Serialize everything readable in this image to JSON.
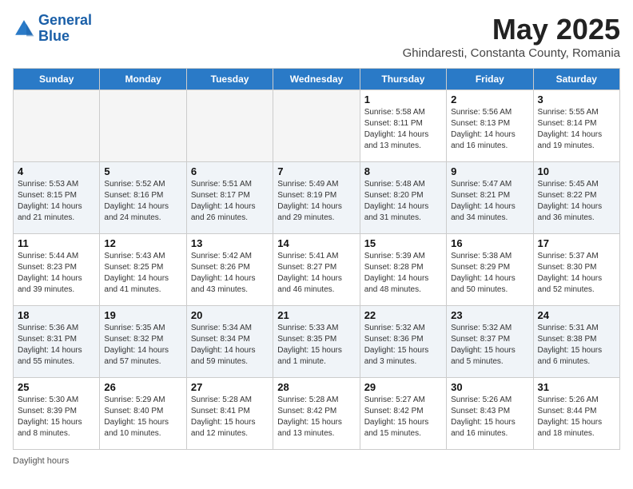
{
  "header": {
    "logo_line1": "General",
    "logo_line2": "Blue",
    "month": "May 2025",
    "location": "Ghindaresti, Constanta County, Romania"
  },
  "days_of_week": [
    "Sunday",
    "Monday",
    "Tuesday",
    "Wednesday",
    "Thursday",
    "Friday",
    "Saturday"
  ],
  "weeks": [
    [
      {
        "day": "",
        "info": ""
      },
      {
        "day": "",
        "info": ""
      },
      {
        "day": "",
        "info": ""
      },
      {
        "day": "",
        "info": ""
      },
      {
        "day": "1",
        "info": "Sunrise: 5:58 AM\nSunset: 8:11 PM\nDaylight: 14 hours\nand 13 minutes."
      },
      {
        "day": "2",
        "info": "Sunrise: 5:56 AM\nSunset: 8:13 PM\nDaylight: 14 hours\nand 16 minutes."
      },
      {
        "day": "3",
        "info": "Sunrise: 5:55 AM\nSunset: 8:14 PM\nDaylight: 14 hours\nand 19 minutes."
      }
    ],
    [
      {
        "day": "4",
        "info": "Sunrise: 5:53 AM\nSunset: 8:15 PM\nDaylight: 14 hours\nand 21 minutes."
      },
      {
        "day": "5",
        "info": "Sunrise: 5:52 AM\nSunset: 8:16 PM\nDaylight: 14 hours\nand 24 minutes."
      },
      {
        "day": "6",
        "info": "Sunrise: 5:51 AM\nSunset: 8:17 PM\nDaylight: 14 hours\nand 26 minutes."
      },
      {
        "day": "7",
        "info": "Sunrise: 5:49 AM\nSunset: 8:19 PM\nDaylight: 14 hours\nand 29 minutes."
      },
      {
        "day": "8",
        "info": "Sunrise: 5:48 AM\nSunset: 8:20 PM\nDaylight: 14 hours\nand 31 minutes."
      },
      {
        "day": "9",
        "info": "Sunrise: 5:47 AM\nSunset: 8:21 PM\nDaylight: 14 hours\nand 34 minutes."
      },
      {
        "day": "10",
        "info": "Sunrise: 5:45 AM\nSunset: 8:22 PM\nDaylight: 14 hours\nand 36 minutes."
      }
    ],
    [
      {
        "day": "11",
        "info": "Sunrise: 5:44 AM\nSunset: 8:23 PM\nDaylight: 14 hours\nand 39 minutes."
      },
      {
        "day": "12",
        "info": "Sunrise: 5:43 AM\nSunset: 8:25 PM\nDaylight: 14 hours\nand 41 minutes."
      },
      {
        "day": "13",
        "info": "Sunrise: 5:42 AM\nSunset: 8:26 PM\nDaylight: 14 hours\nand 43 minutes."
      },
      {
        "day": "14",
        "info": "Sunrise: 5:41 AM\nSunset: 8:27 PM\nDaylight: 14 hours\nand 46 minutes."
      },
      {
        "day": "15",
        "info": "Sunrise: 5:39 AM\nSunset: 8:28 PM\nDaylight: 14 hours\nand 48 minutes."
      },
      {
        "day": "16",
        "info": "Sunrise: 5:38 AM\nSunset: 8:29 PM\nDaylight: 14 hours\nand 50 minutes."
      },
      {
        "day": "17",
        "info": "Sunrise: 5:37 AM\nSunset: 8:30 PM\nDaylight: 14 hours\nand 52 minutes."
      }
    ],
    [
      {
        "day": "18",
        "info": "Sunrise: 5:36 AM\nSunset: 8:31 PM\nDaylight: 14 hours\nand 55 minutes."
      },
      {
        "day": "19",
        "info": "Sunrise: 5:35 AM\nSunset: 8:32 PM\nDaylight: 14 hours\nand 57 minutes."
      },
      {
        "day": "20",
        "info": "Sunrise: 5:34 AM\nSunset: 8:34 PM\nDaylight: 14 hours\nand 59 minutes."
      },
      {
        "day": "21",
        "info": "Sunrise: 5:33 AM\nSunset: 8:35 PM\nDaylight: 15 hours\nand 1 minute."
      },
      {
        "day": "22",
        "info": "Sunrise: 5:32 AM\nSunset: 8:36 PM\nDaylight: 15 hours\nand 3 minutes."
      },
      {
        "day": "23",
        "info": "Sunrise: 5:32 AM\nSunset: 8:37 PM\nDaylight: 15 hours\nand 5 minutes."
      },
      {
        "day": "24",
        "info": "Sunrise: 5:31 AM\nSunset: 8:38 PM\nDaylight: 15 hours\nand 6 minutes."
      }
    ],
    [
      {
        "day": "25",
        "info": "Sunrise: 5:30 AM\nSunset: 8:39 PM\nDaylight: 15 hours\nand 8 minutes."
      },
      {
        "day": "26",
        "info": "Sunrise: 5:29 AM\nSunset: 8:40 PM\nDaylight: 15 hours\nand 10 minutes."
      },
      {
        "day": "27",
        "info": "Sunrise: 5:28 AM\nSunset: 8:41 PM\nDaylight: 15 hours\nand 12 minutes."
      },
      {
        "day": "28",
        "info": "Sunrise: 5:28 AM\nSunset: 8:42 PM\nDaylight: 15 hours\nand 13 minutes."
      },
      {
        "day": "29",
        "info": "Sunrise: 5:27 AM\nSunset: 8:42 PM\nDaylight: 15 hours\nand 15 minutes."
      },
      {
        "day": "30",
        "info": "Sunrise: 5:26 AM\nSunset: 8:43 PM\nDaylight: 15 hours\nand 16 minutes."
      },
      {
        "day": "31",
        "info": "Sunrise: 5:26 AM\nSunset: 8:44 PM\nDaylight: 15 hours\nand 18 minutes."
      }
    ]
  ],
  "footer": "Daylight hours"
}
